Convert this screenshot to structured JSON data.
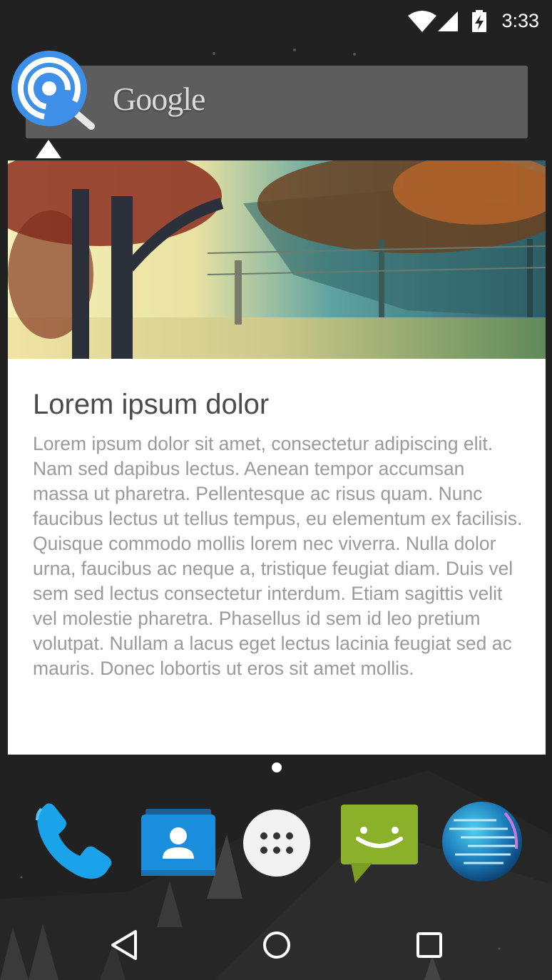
{
  "status_bar": {
    "time": "3:33",
    "icons": [
      "wifi-icon",
      "cell-signal-icon",
      "battery-charging-icon"
    ]
  },
  "search_widget": {
    "logo_text": "Google"
  },
  "overlay": {
    "icon": "wireless-search-icon",
    "accent_color": "#3d8fe8"
  },
  "card": {
    "title": "Lorem ipsum dolor",
    "body": "Lorem ipsum dolor sit amet, consectetur adipiscing elit. Nam sed dapibus lectus. Aenean tempor accumsan massa ut pharetra. Pellentesque ac risus quam. Nunc faucibus lectus ut tellus tempus, eu elementum ex facilisis. Quisque commodo mollis lorem nec viverra. Nulla dolor urna, faucibus ac neque a, tristique feugiat diam. Duis vel sem sed lectus consectetur interdum. Etiam sagittis velit vel molestie pharetra. Phasellus id sem id leo pretium volutpat. Nullam a lacus eget lectus lacinia feugiat sed ac mauris. Donec lobortis ut eros sit amet mollis.",
    "image": "forest-sunlight-photo"
  },
  "dock": {
    "apps": [
      {
        "icon": "phone-icon"
      },
      {
        "icon": "contacts-icon"
      },
      {
        "icon": "app-drawer-icon"
      },
      {
        "icon": "messaging-icon"
      },
      {
        "icon": "browser-globe-icon"
      }
    ]
  },
  "nav_bar": {
    "buttons": [
      "back-icon",
      "home-icon",
      "recents-icon"
    ]
  },
  "colors": {
    "wallpaper": "#212121",
    "phone_blue": "#1aa3e8",
    "messaging_green": "#8bb12b"
  }
}
